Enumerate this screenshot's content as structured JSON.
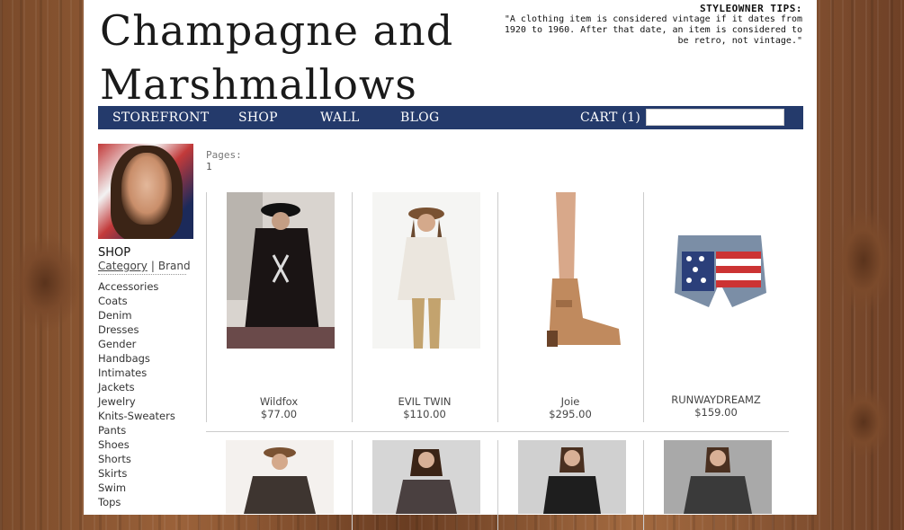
{
  "site": {
    "logo_line1": "Champagne and",
    "logo_line2": "Marshmallows"
  },
  "tips": {
    "heading": "STYLEOWNER TIPS:",
    "text": "\"A clothing item is considered vintage if it dates from 1920 to 1960. After that date, an item is considered to be retro, not vintage.\""
  },
  "nav": {
    "storefront": "STOREFRONT",
    "shop": "SHOP",
    "wall": "WALL",
    "blog": "BLOG",
    "cart": "CART (1)",
    "search_value": ""
  },
  "sidebar": {
    "shop_title": "SHOP",
    "filter_category": "Category",
    "filter_separator": "|",
    "filter_brand": "Brand",
    "categories": [
      "Accessories",
      "Coats",
      "Denim",
      "Dresses",
      "Gender",
      "Handbags",
      "Intimates",
      "Jackets",
      "Jewelry",
      "Knits-Sweaters",
      "Pants",
      "Shoes",
      "Shorts",
      "Skirts",
      "Swim",
      "Tops"
    ]
  },
  "content": {
    "pages_label": "Pages:",
    "pages_current": "1",
    "products": [
      {
        "brand": "Wildfox",
        "price": "$77.00"
      },
      {
        "brand": "EVIL TWIN",
        "price": "$110.00"
      },
      {
        "brand": "Joie",
        "price": "$295.00"
      },
      {
        "brand": "RUNWAYDREAMZ",
        "price": "$159.00"
      }
    ]
  },
  "colors": {
    "nav_bg": "#243a6b",
    "page_bg": "#ffffff"
  }
}
